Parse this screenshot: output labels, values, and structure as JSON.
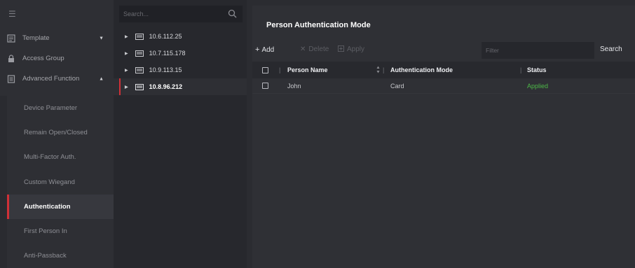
{
  "nav": {
    "items": [
      {
        "label": "Template",
        "icon": "template-icon",
        "expanded": false
      },
      {
        "label": "Access Group",
        "icon": "lock-icon"
      },
      {
        "label": "Advanced Function",
        "icon": "document-icon",
        "expanded": true
      }
    ],
    "sub_items": [
      {
        "label": "Device Parameter"
      },
      {
        "label": "Remain Open/Closed"
      },
      {
        "label": "Multi-Factor Auth."
      },
      {
        "label": "Custom Wiegand"
      },
      {
        "label": "Authentication",
        "active": true
      },
      {
        "label": "First Person In"
      },
      {
        "label": "Anti-Passback"
      }
    ]
  },
  "tree": {
    "search_placeholder": "Search...",
    "devices": [
      {
        "label": "10.6.112.25"
      },
      {
        "label": "10.7.115.178"
      },
      {
        "label": "10.9.113.15"
      },
      {
        "label": "10.8.96.212",
        "selected": true
      }
    ]
  },
  "main": {
    "title": "Person Authentication Mode",
    "toolbar": {
      "add_label": "Add",
      "delete_label": "Delete",
      "apply_label": "Apply",
      "filter_placeholder": "Filter",
      "search_label": "Search"
    },
    "table": {
      "columns": [
        "Person Name",
        "Authentication Mode",
        "Status"
      ],
      "rows": [
        {
          "name": "John",
          "mode": "Card",
          "status": "Applied"
        }
      ]
    }
  },
  "colors": {
    "accent": "#d03037",
    "status_applied": "#4db848"
  }
}
